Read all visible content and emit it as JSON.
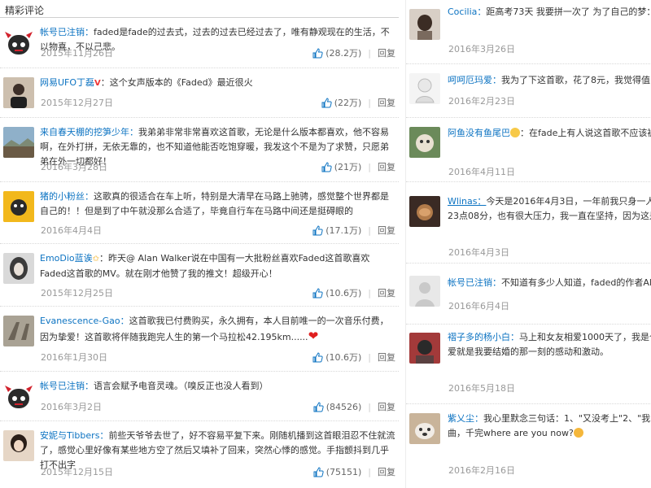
{
  "section": {
    "title": "精彩评论"
  },
  "icons": {
    "like": "thumbs-up-icon",
    "vip": "vip-badge-icon",
    "heart": "heart-icon",
    "star": "star-icon",
    "emoji": "emoji-icon"
  },
  "colors": {
    "username": "#0c73c2",
    "date": "#999999",
    "text": "#333333",
    "heart": "#e01f1f"
  },
  "left_comments": [
    {
      "user": "帐号已注销：",
      "text": "faded是fade的过去式，过去的过去已经过去了，唯有静观现在的生活，不以物喜，不以己悲。",
      "date": "2015年11月26日",
      "likes": "(28.2万)",
      "reply": "回复"
    },
    {
      "user": "网易UFO丁磊",
      "badge": "V",
      "text": "：这个女声版本的《Faded》最近很火",
      "date": "2015年12月27日",
      "likes": "(22万)",
      "reply": "回复"
    },
    {
      "user": "来自春天棚的挖笋少年：",
      "text": "我弟弟非常非常喜欢这首歌，无论是什么版本都喜欢，他不容易啊，在外打拼，无依无靠的，也不知道他能否吃饱穿暖，我发这个不是为了求赞，只愿弟弟在外一切都好！",
      "date": "2016年3月28日",
      "likes": "(21万)",
      "reply": "回复"
    },
    {
      "user": "猪的小粉丝：",
      "text": "这歌真的很适合在车上听，特别是大清早在马路上驰骋，感觉整个世界都是自己的！！但是到了中午就没那么合适了，毕竟自行车在马路中间还是挺碍眼的",
      "date": "2016年4月4日",
      "likes": "(17.1万)",
      "reply": "回复"
    },
    {
      "user": "EmoDio蓝诶",
      "text": "：昨天@ Alan Walker说在中国有一大批粉丝喜欢Faded这首歌喜欢Faded这首歌的MV。就在刚才他赞了我的推文！超级开心！",
      "date": "2015年12月25日",
      "likes": "(10.6万)",
      "reply": "回复"
    },
    {
      "user": "Evanescence-Gao：",
      "text": "这首歌我已付费购买，永久拥有，本人目前唯一的一次音乐付费，因为挚爱！这首歌将伴随我跑完人生的第一个马拉松42.195km......",
      "date": "2016年1月30日",
      "likes": "(10.6万)",
      "reply": "回复"
    },
    {
      "user": "帐号已注销：",
      "text": "语言会赋予电音灵魂。（嗅反正也没人看到）",
      "date": "2016年3月2日",
      "likes": "(84526)",
      "reply": "回复"
    },
    {
      "user": "安妮与Tibbers：",
      "text": "前些天爷爷去世了，好不容易平复下来。刚随机播到这首眼泪忍不住就流了，感觉心里好像有某些地方空了然后又填补了回来，突然心悸的感觉。手指颤抖到几乎打不出字",
      "date": "2015年12月15日",
      "likes": "(75151)",
      "reply": "回复"
    }
  ],
  "right_comments": [
    {
      "user": "Cocilia：",
      "text": "距高考73天 我要拼一次了 为了自己的梦：为了父母faded.",
      "date": "2016年3月26日"
    },
    {
      "user": "呵呵厄玛爱：",
      "text": "我为了下这首歌，花了8元，我觉得值",
      "date": "2016年2月23日"
    },
    {
      "user": "阿鱼没有鱼尾巴",
      "text": "：在fade上有人说这首歌不应该被填词，神曲",
      "date": "2016年4月11日"
    },
    {
      "user": "Wlinas：",
      "text": "今天是2016年4月3日，一年前我只身一人来到北京，还在为自己的梦想努力的奋斗着。现在是晚上23点08分，也有很大压力，我一直在坚持，因为这是我最初的梦想",
      "date": "2016年4月3日"
    },
    {
      "user": "帐号已注销：",
      "text": "不知道有多少人知道，faded的作者Alan Walker",
      "date": "2016年6月4日"
    },
    {
      "user": "褶子多的杨小白：",
      "text": "马上和女友相爱1000天了，我是个军人，很难。希望今年我们的勇气能有个结果……吴楠 爱就是我要结婚的那一刻的感动和激动。",
      "date": "2016年5月18日"
    },
    {
      "user": "紫乂尘：",
      "text": "我心里默念三句话：1、\"又没考上\"2、\"我的大哥今年这个时代一穷二白的年轻人该如何生存?重复此曲，千完where are you now?",
      "date": "2016年2月16日"
    }
  ]
}
